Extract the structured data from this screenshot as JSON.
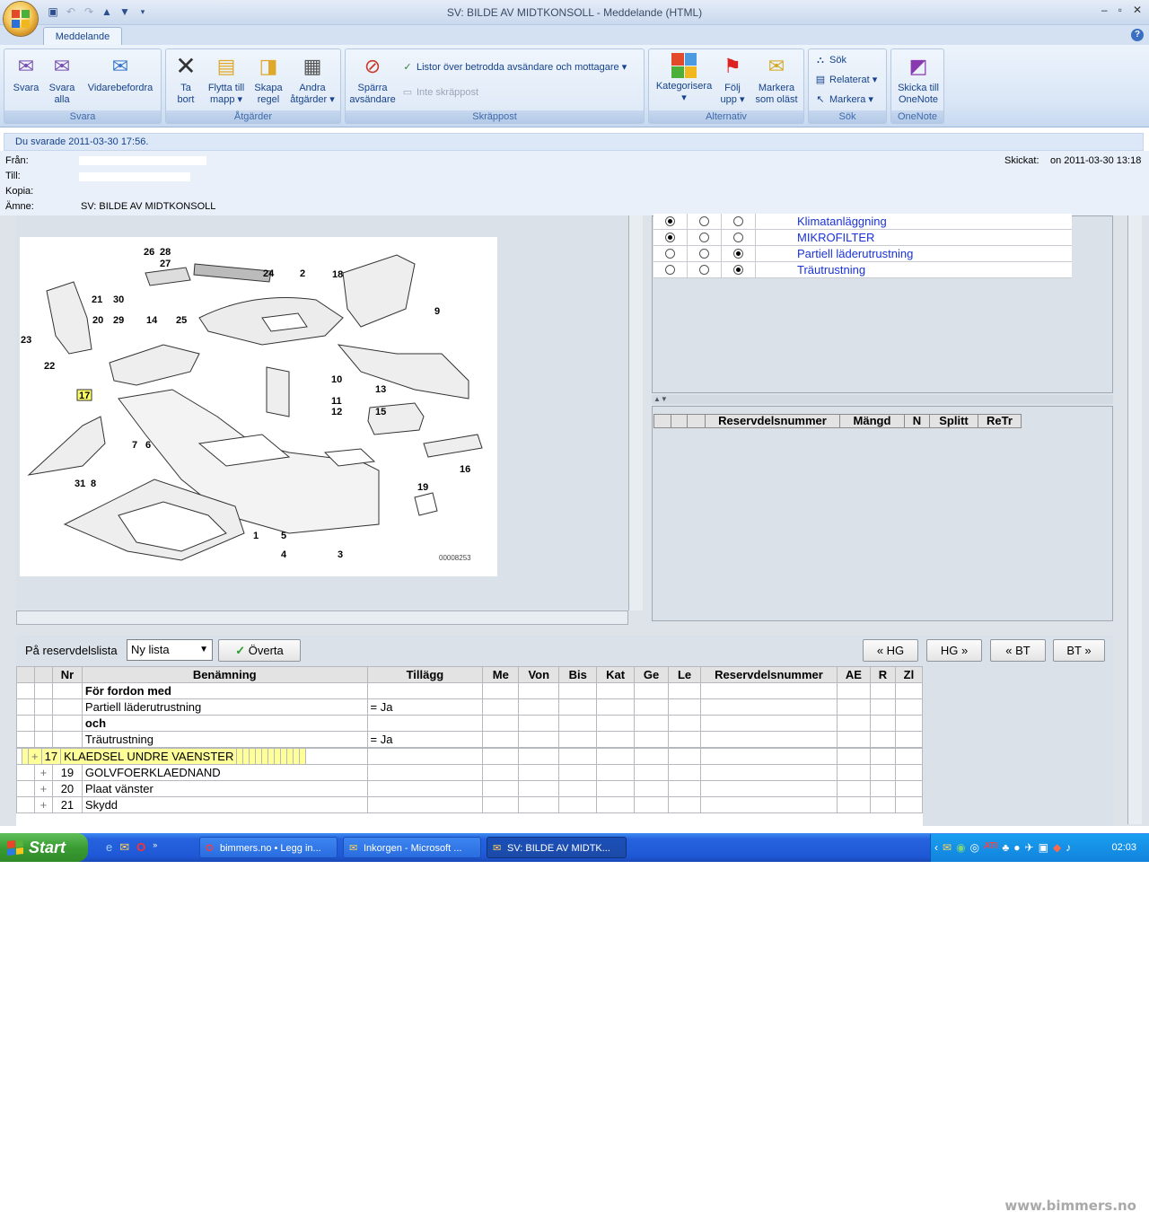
{
  "window": {
    "title": "SV: BILDE AV MIDTKONSOLL  -  Meddelande (HTML)",
    "tab": "Meddelande",
    "help": "?"
  },
  "ribbon": {
    "groups": {
      "svara": "Svara",
      "atgarder": "Åtgärder",
      "skrappost": "Skräppost",
      "alternativ": "Alternativ",
      "sok": "Sök",
      "onenote": "OneNote"
    },
    "buttons": {
      "svara": "Svara",
      "svara_alla_1": "Svara",
      "svara_alla_2": "alla",
      "vidarebefordra": "Vidarebefordra",
      "ta_bort_1": "Ta",
      "ta_bort_2": "bort",
      "flytta_1": "Flytta till",
      "flytta_2": "mapp ▾",
      "skapa_1": "Skapa",
      "skapa_2": "regel",
      "andra_1": "Andra",
      "andra_2": "åtgärder ▾",
      "sparra_1": "Spärra",
      "sparra_2": "avsändare",
      "listor": "Listor över betrodda avsändare och mottagare ▾",
      "inte_skrappost": "Inte skräppost",
      "kategorisera_1": "Kategorisera",
      "kategorisera_2": "▾",
      "folj_1": "Följ",
      "folj_2": "upp ▾",
      "markera_olast_1": "Markera",
      "markera_olast_2": "som oläst",
      "sok": "Sök",
      "relaterat": "Relaterat ▾",
      "markera": "Markera ▾",
      "skicka_1": "Skicka till",
      "skicka_2": "OneNote"
    }
  },
  "message": {
    "info": "Du svarade 2011-03-30 17:56.",
    "from_label": "Från:",
    "to_label": "Till:",
    "cc_label": "Kopia:",
    "subject_label": "Ämne:",
    "subject": "SV: BILDE AV MIDTKONSOLL",
    "sent_label": "Skickat:",
    "sent": "on 2011-03-30 13:18"
  },
  "diagram": {
    "code": "00008253",
    "labels": [
      "26",
      "28",
      "27",
      "24",
      "2",
      "18",
      "21",
      "30",
      "20",
      "29",
      "14",
      "25",
      "9",
      "23",
      "22",
      "10",
      "11",
      "12",
      "13",
      "17",
      "15",
      "7",
      "6",
      "16",
      "31",
      "8",
      "19",
      "1",
      "5",
      "4",
      "3"
    ]
  },
  "options": [
    {
      "label": "Klimatanläggning",
      "radios": [
        true,
        false,
        false
      ]
    },
    {
      "label": "MIKROFILTER",
      "radios": [
        true,
        false,
        false
      ]
    },
    {
      "label": "Partiell läderutrustning",
      "radios": [
        false,
        false,
        true
      ]
    },
    {
      "label": "Träutrustning",
      "radios": [
        false,
        false,
        true
      ]
    }
  ],
  "right_table": {
    "headers": [
      "Reservdelsnummer",
      "Mängd",
      "N",
      "Splitt",
      "ReTr"
    ]
  },
  "parts_toolbar": {
    "label": "På reservdelslista",
    "select_value": "Ny lista",
    "overta": "Överta",
    "prev_hg": "« HG",
    "next_hg": "HG »",
    "prev_bt": "« BT",
    "next_bt": "BT »"
  },
  "parts_table": {
    "headers": [
      "",
      "",
      "Nr",
      "Benämning",
      "Tillägg",
      "Me",
      "Von",
      "Bis",
      "Kat",
      "Ge",
      "Le",
      "Reservdelsnummer",
      "AE",
      "R",
      "Zl"
    ],
    "rows": [
      {
        "exp": "",
        "nr": "",
        "name": "För fordon med",
        "add": "",
        "bold": true
      },
      {
        "exp": "",
        "nr": "",
        "name": "Partiell läderutrustning",
        "add": "= Ja"
      },
      {
        "exp": "",
        "nr": "",
        "name": "och",
        "add": "",
        "bold": true
      },
      {
        "exp": "",
        "nr": "",
        "name": "Träutrustning",
        "add": "= Ja"
      },
      {
        "exp": "+",
        "nr": "17",
        "name": "KLAEDSEL UNDRE VAENSTER",
        "add": "",
        "highlight": true
      },
      {
        "exp": "",
        "nr": "",
        "name": "",
        "add": ""
      },
      {
        "exp": "+",
        "nr": "19",
        "name": "GOLVFOERKLAEDNAND",
        "add": ""
      },
      {
        "exp": "+",
        "nr": "20",
        "name": "Plaat vänster",
        "add": ""
      },
      {
        "exp": "+",
        "nr": "21",
        "name": "Skydd",
        "add": ""
      }
    ]
  },
  "taskbar": {
    "start": "Start",
    "tasks": [
      "bimmers.no • Legg in...",
      "Inkorgen - Microsoft ...",
      "SV: BILDE AV MIDTK..."
    ],
    "clock": "02:03"
  },
  "watermark": "www.bimmers.no",
  "colors": {
    "highlight_row": "#ffff99",
    "option_text": "#1a32d8",
    "ribbon_text": "#15428b"
  }
}
